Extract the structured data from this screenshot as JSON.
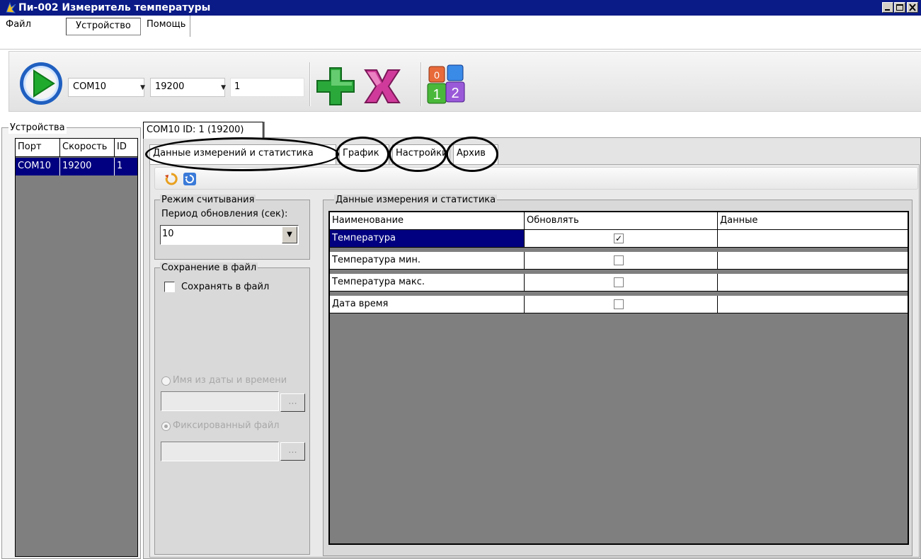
{
  "window": {
    "title": "Пи-002 Измеритель температуры"
  },
  "menu": {
    "file": "Файл",
    "device": "Устройство",
    "help": "Помощь"
  },
  "toolbar": {
    "port": "COM10",
    "speed": "19200",
    "device_id": "1"
  },
  "devices": {
    "legend": "Устройства",
    "columns": [
      "Порт",
      "Скорость",
      "ID"
    ],
    "rows": [
      {
        "port": "COM10",
        "speed": "19200",
        "id": "1"
      }
    ]
  },
  "device_tab": "COM10 ID: 1 (19200)",
  "tabs": {
    "data": "Данные измерений и статистика",
    "graph": "График",
    "settings": "Настройки",
    "archive": "Архив"
  },
  "read_mode": {
    "legend": "Режим считывания",
    "period_label": "Период обновления (сек):",
    "period_value": "10"
  },
  "save_to_file": {
    "legend": "Сохранение в файл",
    "checkbox_label": "Сохранять в файл",
    "checked": false,
    "radio_datetime": "Имя из даты и времени",
    "radio_fixed": "Фиксированный файл",
    "browse_label": "..."
  },
  "measurements": {
    "legend": "Данные измерения и статистика",
    "columns": [
      "Наименование",
      "Обновлять",
      "Данные"
    ],
    "rows": [
      {
        "name": "Температура",
        "update": true,
        "data": ""
      },
      {
        "name": "Температура мин.",
        "update": false,
        "data": ""
      },
      {
        "name": "Температура макс.",
        "update": false,
        "data": ""
      },
      {
        "name": "Дата время",
        "update": false,
        "data": ""
      }
    ]
  },
  "icons": {
    "title": "app-icon",
    "run": "play-icon",
    "add": "add-plus-icon",
    "delete": "delete-x-icon",
    "numbers": "numbered-cubes-icon",
    "refresh_a": "refresh-orange-icon",
    "refresh_b": "refresh-blue-icon"
  },
  "colors": {
    "titlebar": "#0a1a86",
    "selection": "#000080",
    "grid_bg": "#7f7f7f"
  }
}
